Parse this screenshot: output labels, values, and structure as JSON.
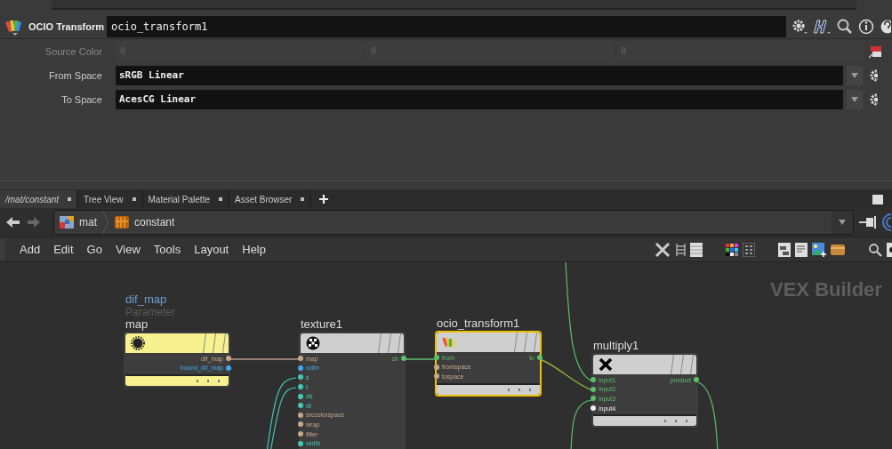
{
  "parameter_editor": {
    "node_type": "OCIO Transform",
    "node_name": "ocio_transform1",
    "parms": [
      {
        "kind": "vector",
        "label": "Source Color",
        "disabled": true,
        "values": [
          "0",
          "0",
          "0"
        ]
      },
      {
        "kind": "menu",
        "label": "From Space",
        "disabled": false,
        "value": "sRGB Linear"
      },
      {
        "kind": "menu",
        "label": "To Space",
        "disabled": false,
        "value": "AcesCG Linear"
      }
    ]
  },
  "pane_tabs": [
    {
      "label": "/mat/constant",
      "selected": true
    },
    {
      "label": "Tree View",
      "selected": false
    },
    {
      "label": "Material Palette",
      "selected": false
    },
    {
      "label": "Asset Browser",
      "selected": false
    }
  ],
  "path": [
    {
      "kind": "subnet",
      "label": "mat"
    },
    {
      "kind": "material",
      "label": "constant"
    }
  ],
  "menu": [
    "Add",
    "Edit",
    "Go",
    "View",
    "Tools",
    "Layout",
    "Help"
  ],
  "network": {
    "context_label": "VEX Builder",
    "nodes": [
      {
        "name": "map",
        "kind": "parameter",
        "parm_name": "dif_map",
        "parm_caption": "Parameter",
        "color": "#f7f28f",
        "selected": false,
        "outputs": [
          {
            "name": "dif_map",
            "color": "#c8a88a"
          },
          {
            "name": "bound_dif_map",
            "color": "#3fa9ec"
          }
        ]
      },
      {
        "name": "texture1",
        "kind": "texture",
        "color": "#cfcfcf",
        "selected": false,
        "inputs": [
          {
            "name": "map",
            "color": "#c8a88a"
          },
          {
            "name": "udim",
            "color": "#3fa9ec"
          },
          {
            "name": "s",
            "color": "#45c7b8"
          },
          {
            "name": "t",
            "color": "#45c7b8"
          },
          {
            "name": "ds",
            "color": "#45c7b8"
          },
          {
            "name": "dt",
            "color": "#45c7b8"
          },
          {
            "name": "srccolorspace",
            "color": "#c8a88a"
          },
          {
            "name": "wrap",
            "color": "#c8a88a"
          },
          {
            "name": "filter",
            "color": "#c8a88a"
          },
          {
            "name": "width",
            "color": "#45c7b8"
          }
        ],
        "outputs": [
          {
            "name": "clr",
            "color": "#5cbf6a"
          }
        ]
      },
      {
        "name": "ocio_transform1",
        "kind": "ocio",
        "color": "#cfcfcf",
        "selected": true,
        "inputs": [
          {
            "name": "from",
            "color": "#5cbf6a"
          },
          {
            "name": "fromspace",
            "color": "#c8a88a"
          },
          {
            "name": "tospace",
            "color": "#c8a88a"
          }
        ],
        "outputs": [
          {
            "name": "to",
            "color": "#5cbf6a"
          }
        ]
      },
      {
        "name": "multiply1",
        "kind": "multiply",
        "color": "#cfcfcf",
        "selected": false,
        "inputs": [
          {
            "name": "input1",
            "color": "#5cbf6a"
          },
          {
            "name": "input2",
            "color": "#5cbf6a"
          },
          {
            "name": "input3",
            "color": "#5cbf6a"
          },
          {
            "name": "input4",
            "color": "#f0f0f0"
          }
        ],
        "outputs": [
          {
            "name": "product",
            "color": "#5cbf6a"
          }
        ]
      }
    ]
  }
}
